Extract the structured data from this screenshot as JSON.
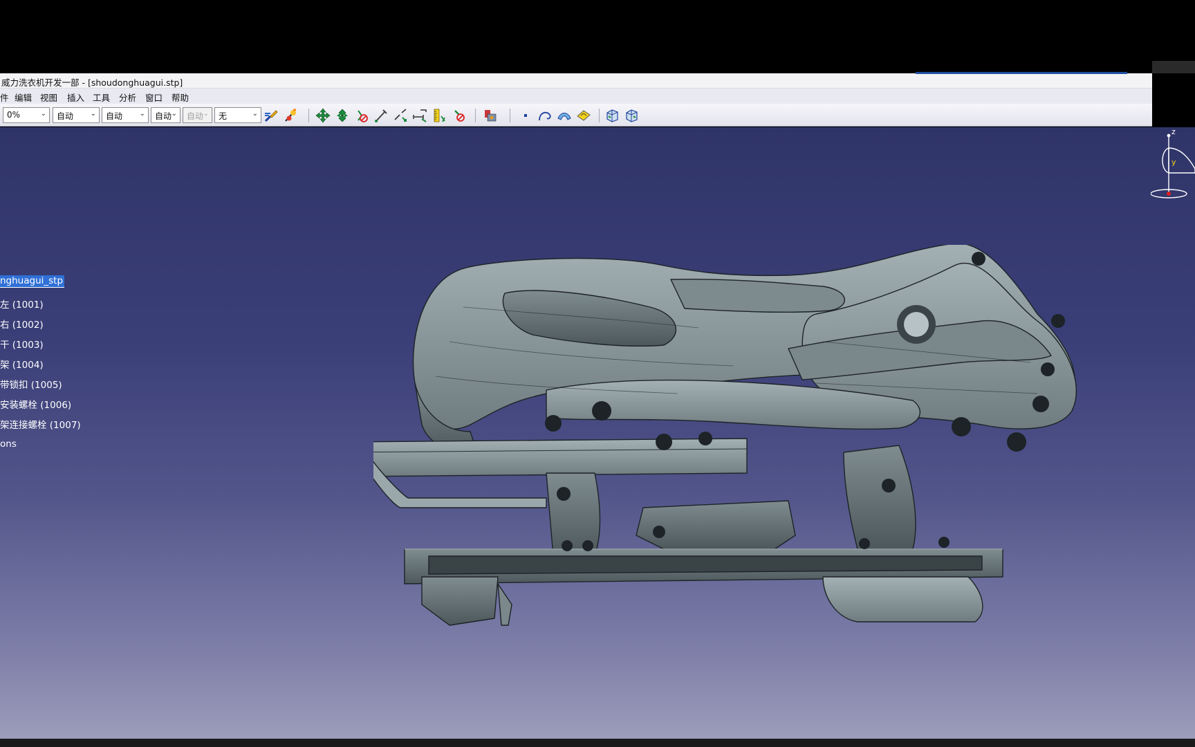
{
  "window": {
    "title": "威力洗衣机开发一部 - [shoudonghuagui.stp]"
  },
  "menu": {
    "items": [
      "件",
      "编辑",
      "视图",
      "插入",
      "工具",
      "分析",
      "窗口",
      "帮助"
    ]
  },
  "toolbar": {
    "combo_zoom": "0%",
    "combo_1": "自动",
    "combo_2": "自动",
    "combo_3": "自动",
    "combo_4": "自动",
    "combo_5": "无",
    "icons": [
      "paint-brush-icon",
      "magic-wand-icon",
      "pan-icon",
      "rotate-icon",
      "fly-icon",
      "measure-icon",
      "snap-icon",
      "ruler-icon",
      "no-measure-icon",
      "catalog-icon",
      "point-icon",
      "curve-icon",
      "surface-icon",
      "sketch-icon",
      "view-icon",
      "view-alt-icon"
    ]
  },
  "tree": {
    "root": "nghuagui_stp",
    "items": [
      "左 (1001)",
      "右 (1002)",
      "干 (1003)",
      "架 (1004)",
      "带锁扣 (1005)",
      "安装螺栓 (1006)",
      "架连接螺栓 (1007)",
      "ons"
    ]
  },
  "compass": {
    "z_label": "z",
    "y_label": "y"
  },
  "colors": {
    "viewport_top": "#2f3468",
    "viewport_bottom": "#9c9cba",
    "model_fill": "#8c9a9f",
    "selection": "#2f6fd6"
  }
}
